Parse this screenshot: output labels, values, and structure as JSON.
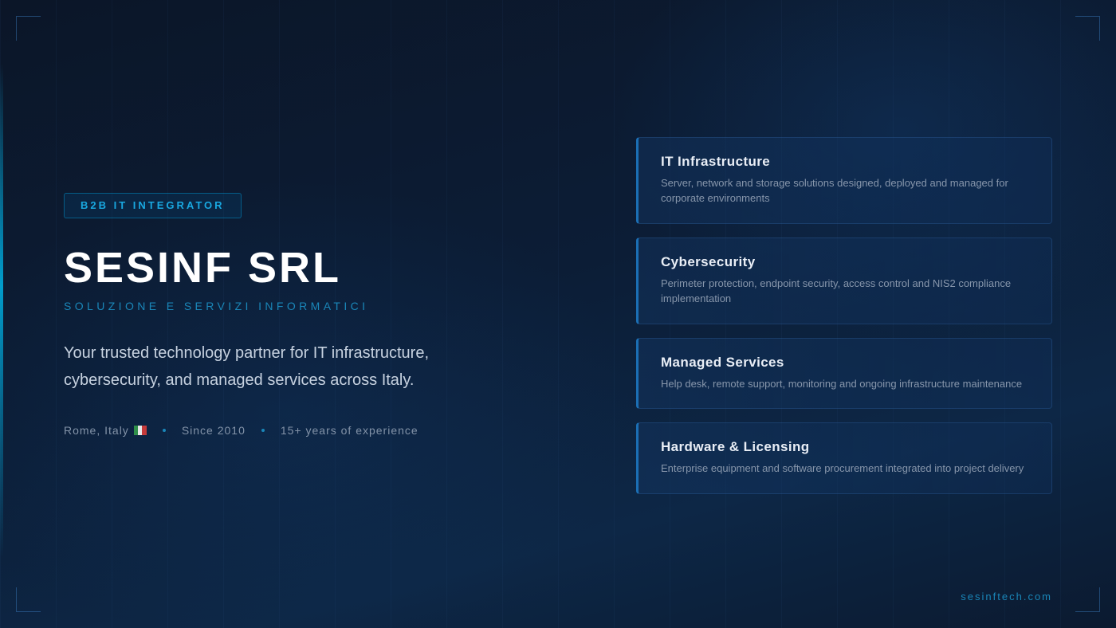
{
  "badge": "B2B IT INTEGRATOR",
  "title": "SESINF SRL",
  "subtitle": "SOLUZIONE E SERVIZI INFORMATICI",
  "tagline": "Your trusted technology partner for IT infrastructure, cybersecurity, and managed services across Italy.",
  "meta": {
    "location": "Rome, Italy",
    "flag_icon": "italy-flag-icon",
    "since": "Since 2010",
    "experience": "15+ years of experience"
  },
  "services": [
    {
      "title": "IT Infrastructure",
      "description": "Server, network and storage solutions designed, deployed and managed for corporate environments"
    },
    {
      "title": "Cybersecurity",
      "description": "Perimeter protection, endpoint security, access control and NIS2 compliance implementation"
    },
    {
      "title": "Managed Services",
      "description": "Help desk, remote support, monitoring and ongoing infrastructure maintenance"
    },
    {
      "title": "Hardware & Licensing",
      "description": "Enterprise equipment and software procurement integrated into project delivery"
    }
  ],
  "footer": {
    "url": "sesinftech.com"
  },
  "colors": {
    "accent": "#19a8e0",
    "background": "#0c1d36",
    "card_border": "#1b6fb5"
  }
}
